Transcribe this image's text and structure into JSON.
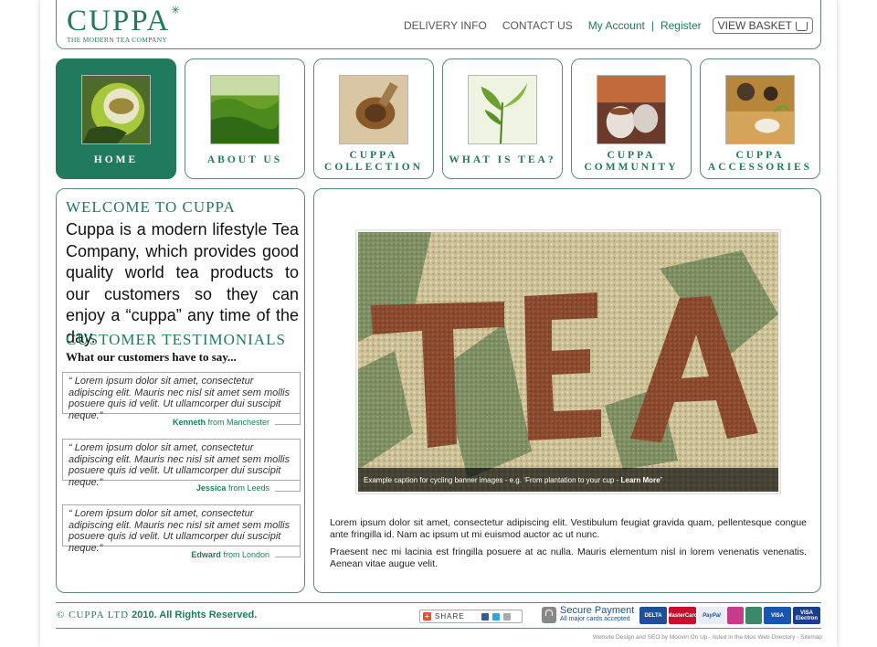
{
  "header": {
    "logo_text": "CUPPA",
    "logo_tagline": "THE MODERN TEA COMPANY",
    "nav": {
      "delivery": "DELIVERY INFO",
      "contact": "CONTACT US",
      "account": "My Account",
      "separator": "|",
      "register": "Register",
      "basket": "VIEW BASKET"
    }
  },
  "main_nav": [
    {
      "label": "HOME",
      "active": true
    },
    {
      "label": "ABOUT US"
    },
    {
      "label_1": "CUPPA",
      "label_2": "COLLECTION"
    },
    {
      "label": "WHAT IS TEA?"
    },
    {
      "label_1": "CUPPA",
      "label_2": "COMMUNITY"
    },
    {
      "label_1": "CUPPA",
      "label_2": "ACCESSORIES"
    }
  ],
  "welcome": {
    "heading": "WELCOME TO CUPPA",
    "text": "Cuppa is a modern lifestyle Tea Company, which provides good quality world tea products to our customers so they can enjoy a “cuppa” any time of the day."
  },
  "testimonials": {
    "heading": "CUSTOMER TESTIMONIALS",
    "subheading": "What our customers have to say...",
    "items": [
      {
        "quote": "“ Lorem ipsum dolor sit amet, consectetur adipiscing elit. Mauris nec nisl sit amet sem mollis posuere quis id velit. Ut ullamcorper dui suscipit neque.”",
        "name": "Kenneth",
        "from": "from Manchester"
      },
      {
        "quote": "“ Lorem ipsum dolor sit amet, consectetur adipiscing elit. Mauris nec nisl sit amet sem mollis posuere quis id velit. Ut ullamcorper dui suscipit neque.”",
        "name": "Jessica",
        "from": "from Leeds"
      },
      {
        "quote": "“ Lorem ipsum dolor sit amet, consectetur adipiscing elit. Mauris nec nisl sit amet sem mollis posuere quis id velit. Ut ullamcorper dui suscipit neque.”",
        "name": "Edward",
        "from": "from London"
      }
    ]
  },
  "banner": {
    "caption": "Example caption for cycling banner images - e.g. ‘From plantation to your cup -",
    "caption_link": "Learn More’"
  },
  "main": {
    "p1": "Lorem ipsum dolor sit amet, consectetur adipiscing elit. Vestibulum feugiat gravida quam, pellentesque congue ante fringilla id. Nam ac ipsum ut mi euismod auctor ac ut nunc.",
    "p2": "Praesent nec mi lacinia est fringilla posuere at ac nulla. Mauris elementum nisl in lorem venenatis venenatis. Aenean vitae augue velit."
  },
  "footer": {
    "copyright_symbol": "© CUPPA LTD",
    "copyright_rest": " 2010. All Rights Reserved.",
    "share_label": "SHARE",
    "secure_title": "Secure Payment",
    "secure_sub": "All major cards accepted",
    "cards": [
      "DELTA",
      "MasterCard",
      "PayPal",
      "",
      "",
      "VISA",
      "VISA Electron"
    ],
    "credits": "Website Design and SEO by Moovin On Up - listed in the Moo Web Directory - Sitemap"
  },
  "colors": {
    "brand_green": "#1f7a5e",
    "border_green": "#5e8a7a"
  }
}
